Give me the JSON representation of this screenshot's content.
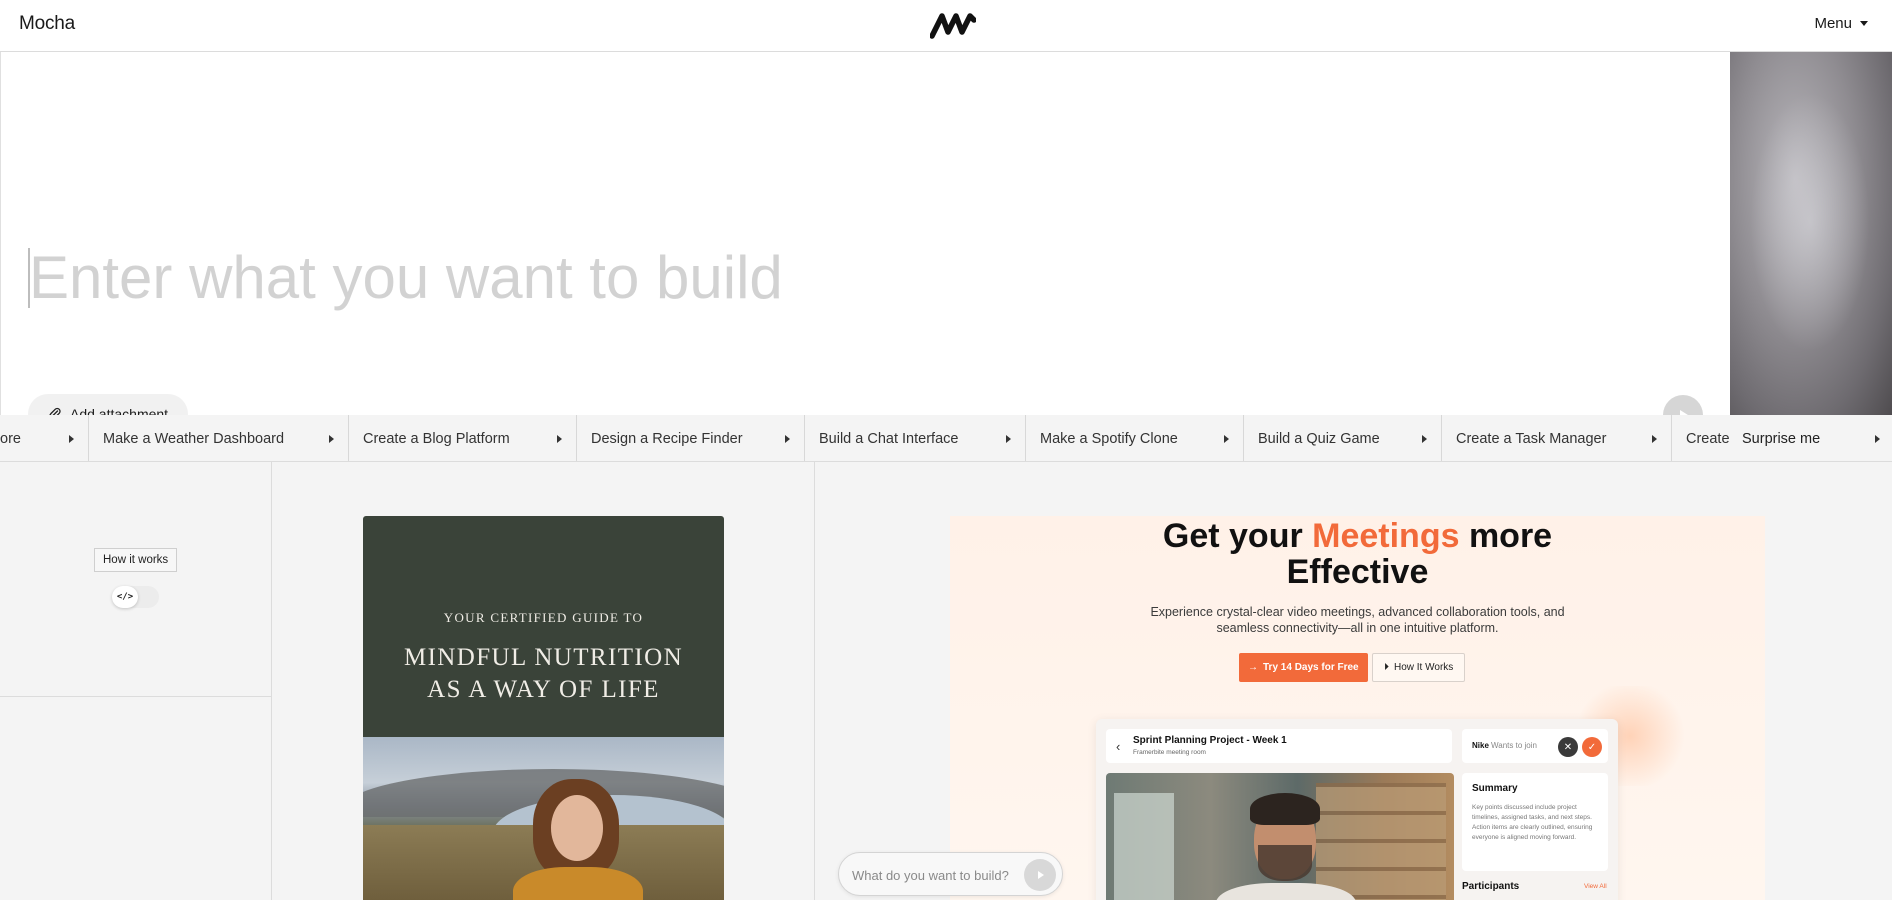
{
  "header": {
    "brand": "Mocha",
    "menu_label": "Menu"
  },
  "prompt": {
    "placeholder": "Enter what you want to build",
    "attach_label": "Add attachment"
  },
  "suggestions": [
    "ore",
    "Make a Weather Dashboard",
    "Create a Blog Platform",
    "Design a Recipe Finder",
    "Build a Chat Interface",
    "Make a Spotify Clone",
    "Build a Quiz Game",
    "Create a Task Manager",
    "Create"
  ],
  "surprise_label": "Surprise me",
  "gallery": {
    "how_it_works": "How it works",
    "code_toggle_icon": "</>",
    "book": {
      "kicker": "YOUR CERTIFIED GUIDE TO",
      "title_line1": "MINDFUL NUTRITION",
      "title_line2": "AS A WAY OF LIFE"
    },
    "meeting": {
      "headline_pre": "Get your ",
      "headline_accent": "Meetings",
      "headline_post": " more",
      "headline_line2": "Effective",
      "subtitle": "Experience crystal-clear video meetings, advanced collaboration tools, and seamless connectivity—all in one intuitive platform.",
      "cta_label": "Try 14 Days for Free",
      "how_label": "How It Works",
      "project_title": "Sprint Planning Project - Week 1",
      "project_sub": "Framerbite meeting room",
      "join_name": "Nike",
      "join_text": "Wants to join",
      "summary_title": "Summary",
      "summary_text": "Key points discussed include project timelines, assigned tasks, and next steps. Action items are clearly outlined, ensuring everyone is aligned moving forward.",
      "participants_label": "Participants",
      "view_all": "View All",
      "accent_color": "#f26a3a"
    }
  },
  "mini_prompt": {
    "placeholder": "What do you want to build?"
  }
}
